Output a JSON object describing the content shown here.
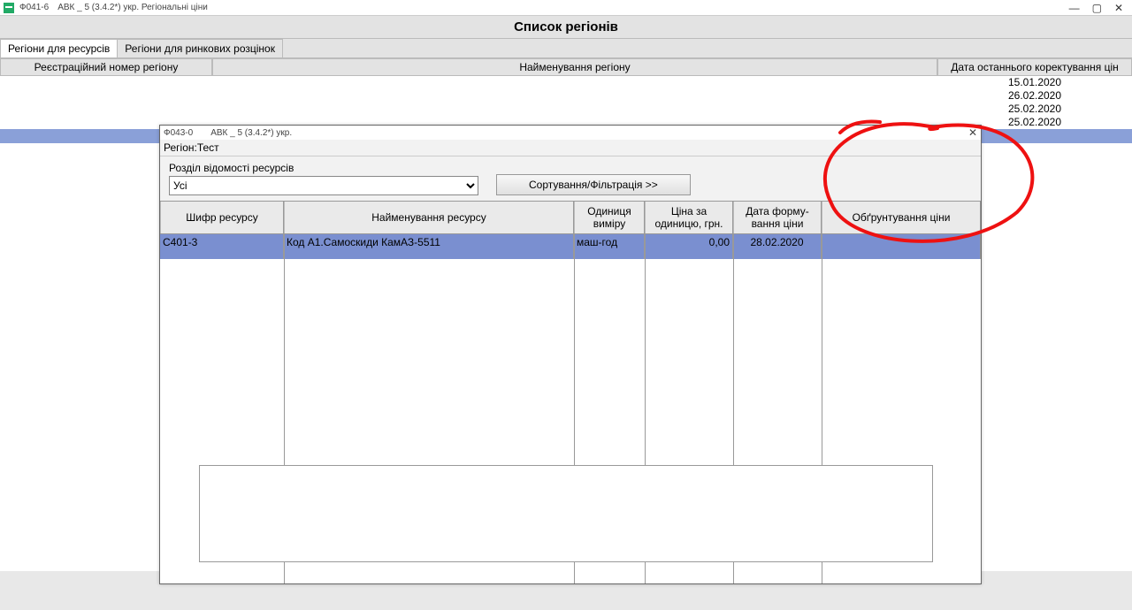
{
  "window": {
    "form_id": "Ф041-6",
    "title": "АВК _ 5 (3.4.2*) укр. Регіональні ціни",
    "min": "—",
    "max": "▢",
    "close": "✕"
  },
  "page_title": "Список регіонів",
  "tabs": {
    "active": "Регіони для ресурсів",
    "inactive": "Регіони для ринкових розцінок"
  },
  "columns": {
    "regnum": "Реєстраційний номер регіону",
    "regname": "Найменування регіону",
    "date": "Дата останнього коректування цін"
  },
  "bg_dates": [
    "15.01.2020",
    "26.02.2020",
    "25.02.2020",
    "25.02.2020"
  ],
  "selected_bg_date_index": 3,
  "modal": {
    "form_id": "Ф043-0",
    "title": "АВК _ 5 (3.4.2*) укр.",
    "close": "✕",
    "region_label": "Регіон:",
    "region_value": "Тест",
    "section_label": "Розділ відомості ресурсів",
    "section_value": "Усі",
    "sort_button": "Сортування/Фільтрація >>",
    "columns": {
      "code": "Шифр ресурсу",
      "name": "Найменування ресурсу",
      "unit": "Одиниця виміру",
      "price": "Ціна за одиницю, грн.",
      "date": "Дата форму-вання ціни",
      "reason": "Обґрунтування ціни"
    },
    "rows": [
      {
        "code": "С401-3",
        "name": "Код А1.Самоскиди КамАЗ-5511",
        "unit": "маш-год",
        "price": "0,00",
        "date": "28.02.2020",
        "reason": ""
      }
    ]
  }
}
